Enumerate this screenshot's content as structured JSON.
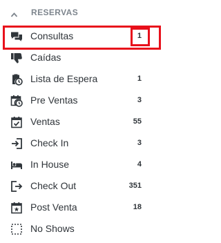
{
  "section": {
    "title": "RESERVAS",
    "collapse_icon": "chevron-up-icon"
  },
  "colors": {
    "highlight": "#e8101b",
    "text": "#2f3439",
    "header_text": "#7d858d",
    "icon": "#30363b"
  },
  "items": [
    {
      "label": "Consultas",
      "count": "1",
      "icon": "chat-bubbles-icon"
    },
    {
      "label": "Caídas",
      "count": "",
      "icon": "thumbs-down-icon"
    },
    {
      "label": "Lista de Espera",
      "count": "1",
      "icon": "clipboard-clock-icon"
    },
    {
      "label": "Pre Ventas",
      "count": "3",
      "icon": "calendar-clock-icon"
    },
    {
      "label": "Ventas",
      "count": "55",
      "icon": "calendar-check-icon"
    },
    {
      "label": "Check In",
      "count": "3",
      "icon": "sign-in-icon"
    },
    {
      "label": "In House",
      "count": "4",
      "icon": "bed-icon"
    },
    {
      "label": "Check Out",
      "count": "351",
      "icon": "sign-out-icon"
    },
    {
      "label": "Post Venta",
      "count": "18",
      "icon": "calendar-star-icon"
    },
    {
      "label": "No Shows",
      "count": "",
      "icon": "dashed-square-icon"
    }
  ]
}
